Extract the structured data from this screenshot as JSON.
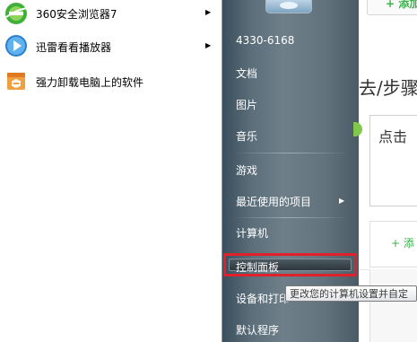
{
  "programs": [
    {
      "label": "360安全浏览器7",
      "icon": "360-browser-icon",
      "has_submenu": true
    },
    {
      "label": "迅雷看看播放器",
      "icon": "xunlei-player-icon",
      "has_submenu": true
    },
    {
      "label": "强力卸载电脑上的软件",
      "icon": "uninstall-software-icon",
      "has_submenu": false
    }
  ],
  "start_menu": {
    "user_label": "4330-6168",
    "documents": "文档",
    "pictures": "图片",
    "music": "音乐",
    "games": "游戏",
    "recent_items": "最近使用的项目",
    "computer": "计算机",
    "control_panel": "控制面板",
    "devices_printers": "设备和打印",
    "default_programs": "默认程序"
  },
  "tooltip": "更改您的计算机设置并自定",
  "background_page": {
    "add_top": "+ 添加",
    "step_title": "去/步骤",
    "click_text": "点击",
    "add_bottom": "+ 添"
  },
  "colors": {
    "highlight_border": "#e0202a",
    "menu_pane": "#63737d",
    "green": "#38b449"
  }
}
